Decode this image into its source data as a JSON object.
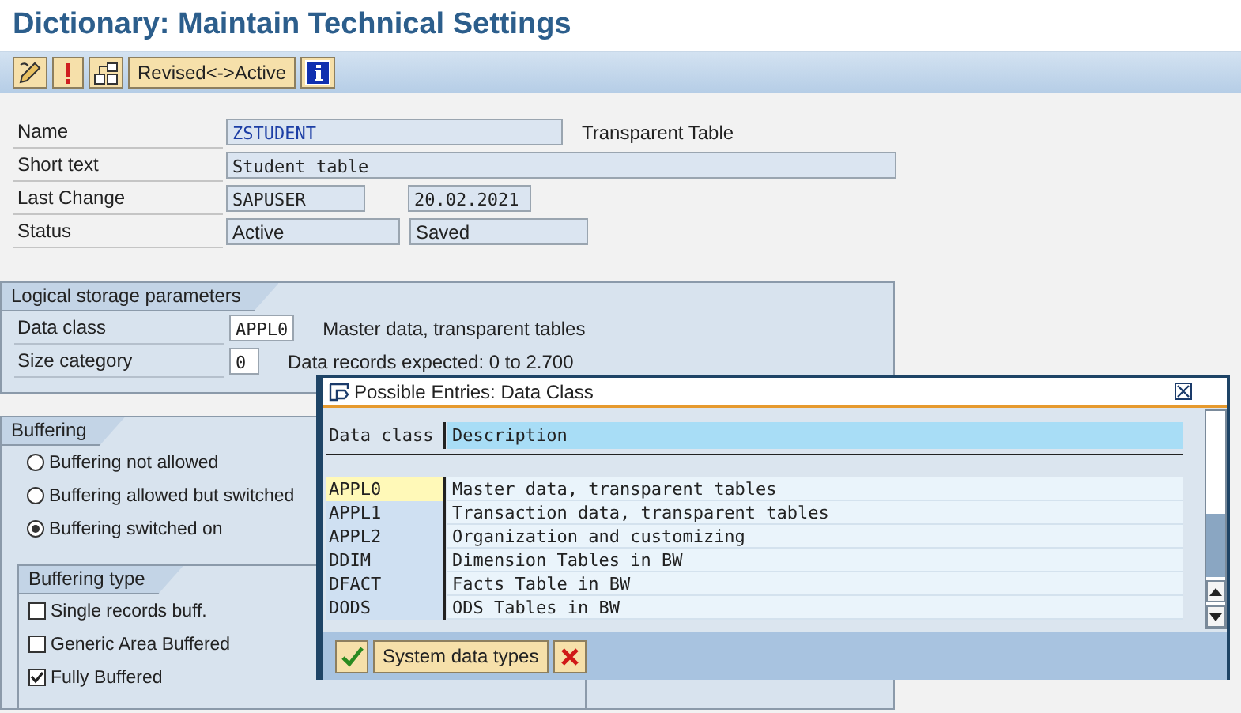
{
  "window": {
    "title": "Dictionary: Maintain Technical Settings"
  },
  "toolbar": [
    {
      "kind": "icon"
    },
    {
      "kind": "icon"
    },
    {
      "kind": "icon"
    },
    {
      "kind": "text",
      "label": "Revised<->Active"
    },
    {
      "kind": "icon"
    }
  ],
  "header": {
    "name": {
      "label": "Name",
      "value": "ZSTUDENT",
      "note": "Transparent Table"
    },
    "short_text": {
      "label": "Short text",
      "value": "Student table"
    },
    "last_change": {
      "label": "Last Change",
      "user": "SAPUSER",
      "date": "20.02.2021"
    },
    "status": {
      "label": "Status",
      "version": "Active",
      "state": "Saved"
    }
  },
  "logical_storage": {
    "title": "Logical storage parameters",
    "rows": [
      {
        "label": "Data class",
        "value": "APPL0",
        "description": "Master data, transparent tables"
      },
      {
        "label": "Size category",
        "value": "0",
        "description": "Data records expected: 0 to 2.700"
      }
    ]
  },
  "buffering": {
    "title": "Buffering",
    "options": [
      {
        "label": "Buffering not allowed",
        "selected": false
      },
      {
        "label": "Buffering allowed but switched",
        "selected": false
      },
      {
        "label": "Buffering switched on",
        "selected": true
      }
    ],
    "buffering_type": {
      "title": "Buffering type",
      "options": [
        {
          "label": "Single records buff.",
          "checked": false
        },
        {
          "label": "Generic Area Buffered",
          "checked": false
        },
        {
          "label": "Fully Buffered",
          "checked": true
        }
      ]
    }
  },
  "popup": {
    "title": "Possible Entries: Data Class",
    "columns": [
      "Data class",
      "Description"
    ],
    "rows": [
      {
        "code": "APPL0",
        "description": "Master data, transparent tables",
        "selected": true
      },
      {
        "code": "APPL1",
        "description": "Transaction data, transparent tables",
        "selected": false
      },
      {
        "code": "APPL2",
        "description": "Organization and customizing",
        "selected": false
      },
      {
        "code": "DDIM",
        "description": "Dimension Tables in BW",
        "selected": false
      },
      {
        "code": "DFACT",
        "description": "Facts Table in BW",
        "selected": false
      },
      {
        "code": "DODS",
        "description": "ODS Tables in BW",
        "selected": false
      }
    ],
    "buttons": [
      {
        "kind": "confirm"
      },
      {
        "kind": "text",
        "label": "System data types"
      },
      {
        "kind": "cancel"
      }
    ]
  }
}
